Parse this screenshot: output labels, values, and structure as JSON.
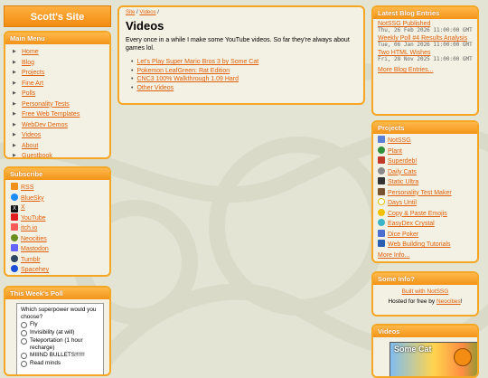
{
  "site": {
    "title": "Scott's Site"
  },
  "colors": {
    "accent": "#f5a623",
    "link": "#e0600a",
    "panel_bg": "#f3f1e3",
    "page_bg": "#e4e4d4"
  },
  "main_menu": {
    "title": "Main Menu",
    "items": [
      "Home",
      "Blog",
      "Projects",
      "Fine Art",
      "Polls",
      "Personality Tests",
      "Free Web Templates",
      "WebDev Demos",
      "Videos",
      "About",
      "Guestbook"
    ]
  },
  "subscribe": {
    "title": "Subscribe",
    "items": [
      {
        "label": "RSS",
        "icon": "rss-icon",
        "color": "#f39019"
      },
      {
        "label": "BlueSky",
        "icon": "bluesky-icon",
        "color": "#1a8cff"
      },
      {
        "label": "X",
        "icon": "x-icon",
        "color": "#111111"
      },
      {
        "label": "YouTube",
        "icon": "youtube-icon",
        "color": "#e02020"
      },
      {
        "label": "itch.io",
        "icon": "itchio-icon",
        "color": "#fa5c5c"
      },
      {
        "label": "Neocities",
        "icon": "neocities-icon",
        "color": "#6b8e23"
      },
      {
        "label": "Mastodon",
        "icon": "mastodon-icon",
        "color": "#6364ff"
      },
      {
        "label": "Tumblr",
        "icon": "tumblr-icon",
        "color": "#2c4762"
      },
      {
        "label": "Spacehey",
        "icon": "spacehey-icon",
        "color": "#1d4ed8"
      }
    ]
  },
  "poll": {
    "title": "This Week's Poll",
    "question": "Which superpower would you choose?",
    "options": [
      "Fly",
      "Invisibility (at will)",
      "Teleportation (1 hour recharge)",
      "MIIIND BULLETS!!!!!!",
      "Read minds"
    ]
  },
  "main": {
    "breadcrumb": {
      "site": "Site",
      "separator": "/",
      "current": "Videos"
    },
    "title": "Videos",
    "intro": "Every once in a while I make some YouTube videos. So far they're always about games lol.",
    "videos": [
      "Let's Play Super Mario Bros 3 by Some Cat",
      "Pokemon LeafGreen: Rat Edition",
      "CNC3 100% Walkthrough 1.09 Hard",
      "Other Videos"
    ]
  },
  "blog": {
    "title": "Latest Blog Entries",
    "entries": [
      {
        "title": "NotSSG Published",
        "date": "Thu, 26 Feb 2026 11:00:00 GMT"
      },
      {
        "title": "Weekly Poll #4 Results Analysis",
        "date": "Tue, 06 Jan 2026 11:00:00 GMT"
      },
      {
        "title": "Two HTML Wishes",
        "date": "Fri, 28 Nov 2025 11:00:00 GMT"
      }
    ],
    "more": "More Blog Entries..."
  },
  "projects": {
    "title": "Projects",
    "items": [
      {
        "label": "NotSSG",
        "icon": "notssg-icon",
        "color": "#5b7fd6"
      },
      {
        "label": "Plant",
        "icon": "plant-icon",
        "color": "#2f8f3a"
      },
      {
        "label": "Superdeb!",
        "icon": "superdeb-icon",
        "color": "#c0392b"
      },
      {
        "label": "Daily Cats",
        "icon": "cat-icon",
        "color": "#8a8a8a"
      },
      {
        "label": "Static Ultra",
        "icon": "static-ultra-icon",
        "color": "#333333"
      },
      {
        "label": "Personality Test Maker",
        "icon": "test-maker-icon",
        "color": "#7a5230"
      },
      {
        "label": "Days Until",
        "icon": "clock-icon",
        "color": "#e6c200"
      },
      {
        "label": "Copy & Paste Emojis",
        "icon": "emoji-icon",
        "color": "#f2c200"
      },
      {
        "label": "EasyDex Crystal",
        "icon": "crystal-icon",
        "color": "#3cb4c8"
      },
      {
        "label": "Dice Poker",
        "icon": "dice-icon",
        "color": "#4a6fd1"
      },
      {
        "label": "Web Building Tutorials",
        "icon": "tutorial-icon",
        "color": "#2b5fb3"
      }
    ],
    "more": "More Info..."
  },
  "some_info": {
    "title": "Some Info?",
    "built_with": "Built with NotSSG",
    "hosted_prefix": "Hosted for free by ",
    "hosted_link": "Neocities",
    "hosted_suffix": "!"
  },
  "videos_widget": {
    "title": "Videos",
    "thumb_text": "Some Cat"
  }
}
